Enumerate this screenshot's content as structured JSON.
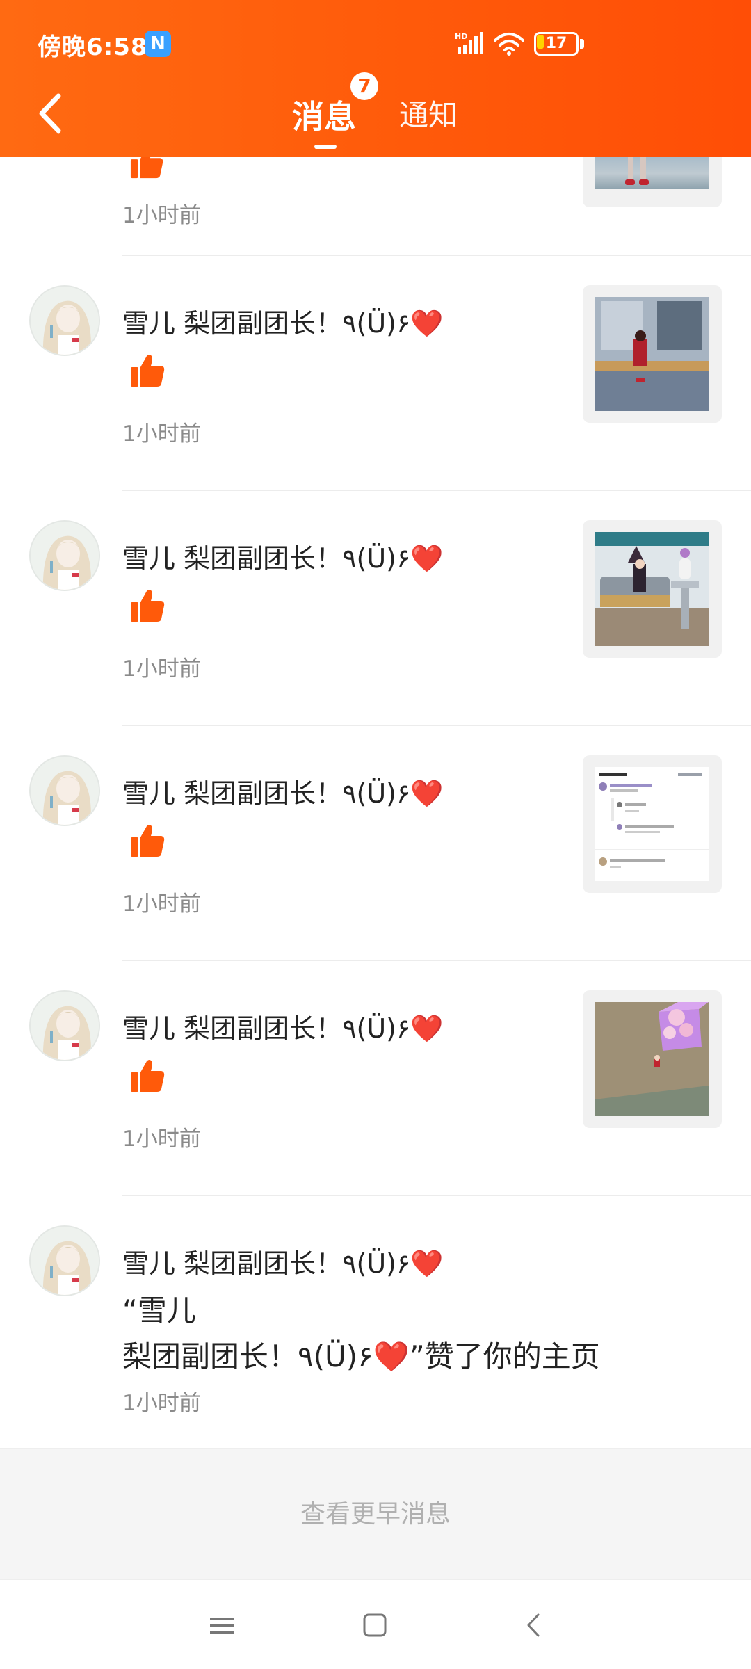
{
  "status_bar": {
    "time": "傍晚6:58",
    "app_icon_letter": "N",
    "signal_label": "HD",
    "battery_level": "17"
  },
  "header": {
    "tabs": [
      {
        "label": "消息",
        "badge": "7",
        "active": true
      },
      {
        "label": "通知",
        "active": false
      }
    ],
    "accent_color": "#ff5a0a"
  },
  "messages": {
    "partial": {
      "time": "1小时前"
    },
    "items": [
      {
        "username": "雪儿  梨团副团长！٩(Ü)۶❤️",
        "time": "1小时前",
        "type": "like",
        "thumb": "game-scene-red-character"
      },
      {
        "username": "雪儿  梨团副团长！٩(Ü)۶❤️",
        "time": "1小时前",
        "type": "like",
        "thumb": "game-scene-witch-on-bench"
      },
      {
        "username": "雪儿  梨团副团长！٩(Ü)۶❤️",
        "time": "1小时前",
        "type": "like",
        "thumb": "comments-screenshot"
      },
      {
        "username": "雪儿  梨团副团长！٩(Ü)۶❤️",
        "time": "1小时前",
        "type": "like",
        "thumb": "game-scene-room-blossom"
      }
    ],
    "last": {
      "username": "雪儿  梨团副团长！٩(Ü)۶❤️",
      "text_line1": "“雪儿",
      "text_line2": "梨团副团长！٩(Ü)۶❤️”赞了你的主页",
      "time": "1小时前"
    }
  },
  "footer": {
    "earlier_label": "查看更早消息"
  }
}
